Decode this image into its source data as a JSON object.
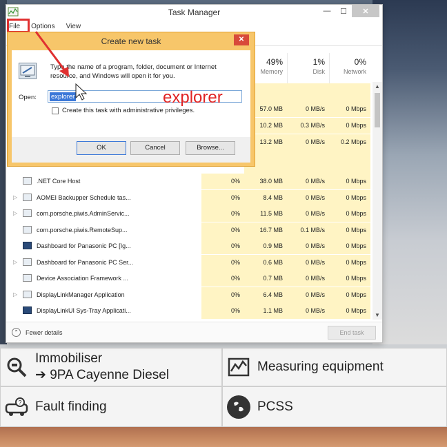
{
  "taskmanager": {
    "title": "Task Manager",
    "menu": [
      "File",
      "Options",
      "View"
    ],
    "columns": [
      {
        "pct": "49%",
        "name": "Memory"
      },
      {
        "pct": "1%",
        "name": "Disk"
      },
      {
        "pct": "0%",
        "name": "Network"
      }
    ],
    "upper_rows": [
      {
        "mem": "57.0 MB",
        "disk": "0 MB/s",
        "net": "0 Mbps"
      },
      {
        "mem": "10.2 MB",
        "disk": "0.3 MB/s",
        "net": "0 Mbps"
      },
      {
        "mem": "13.2 MB",
        "disk": "0 MB/s",
        "net": "0.2 Mbps"
      }
    ],
    "rows": [
      {
        "name": ".NET Core Host",
        "cpu": "0%",
        "mem": "38.0 MB",
        "disk": "0 MB/s",
        "net": "0 Mbps",
        "expand": false,
        "dash": false
      },
      {
        "name": "AOMEI Backupper Schedule tas...",
        "cpu": "0%",
        "mem": "8.4 MB",
        "disk": "0 MB/s",
        "net": "0 Mbps",
        "expand": true,
        "dash": false
      },
      {
        "name": "com.porsche.piwis.AdminServic...",
        "cpu": "0%",
        "mem": "11.5 MB",
        "disk": "0 MB/s",
        "net": "0 Mbps",
        "expand": true,
        "dash": false
      },
      {
        "name": "com.porsche.piwis.RemoteSup...",
        "cpu": "0%",
        "mem": "16.7 MB",
        "disk": "0.1 MB/s",
        "net": "0 Mbps",
        "expand": false,
        "dash": false
      },
      {
        "name": "Dashboard for Panasonic PC [Ig...",
        "cpu": "0%",
        "mem": "0.9 MB",
        "disk": "0 MB/s",
        "net": "0 Mbps",
        "expand": false,
        "dash": true
      },
      {
        "name": "Dashboard for Panasonic PC Ser...",
        "cpu": "0%",
        "mem": "0.6 MB",
        "disk": "0 MB/s",
        "net": "0 Mbps",
        "expand": true,
        "dash": false
      },
      {
        "name": "Device Association Framework ...",
        "cpu": "0%",
        "mem": "0.7 MB",
        "disk": "0 MB/s",
        "net": "0 Mbps",
        "expand": false,
        "dash": false
      },
      {
        "name": "DisplayLinkManager Application",
        "cpu": "0%",
        "mem": "6.4 MB",
        "disk": "0 MB/s",
        "net": "0 Mbps",
        "expand": true,
        "dash": false
      },
      {
        "name": "DisplayLinkUI Sys-Tray Applicati...",
        "cpu": "0%",
        "mem": "1.1 MB",
        "disk": "0 MB/s",
        "net": "0 Mbps",
        "expand": false,
        "dash": true
      }
    ],
    "fewer_details": "Fewer details",
    "end_task": "End task"
  },
  "dialog": {
    "title": "Create new task",
    "description": "Type the name of a program, folder, document or Internet resource, and Windows will open it for you.",
    "open_label": "Open:",
    "input_value": "explorer",
    "checkbox_label": "Create this task with administrative privileges.",
    "ok": "OK",
    "cancel": "Cancel",
    "browse": "Browse..."
  },
  "annotation": {
    "text": "explorer",
    "color": "#e02424"
  },
  "background_app": {
    "tiles": [
      {
        "line1": "Immobiliser",
        "line2": "➔ 9PA Cayenne Diesel",
        "icon": "magnifier-icon"
      },
      {
        "line1": "Measuring equipment",
        "line2": "",
        "icon": "measuring-icon"
      },
      {
        "line1": "Fault finding",
        "line2": "",
        "icon": "car-question-icon"
      },
      {
        "line1": "PCSS",
        "line2": "",
        "icon": "globe-icon"
      }
    ]
  },
  "colors": {
    "highlight_col": "#fff4c4",
    "dialog_border": "#f7c66a",
    "annotation_red": "#e03030"
  }
}
